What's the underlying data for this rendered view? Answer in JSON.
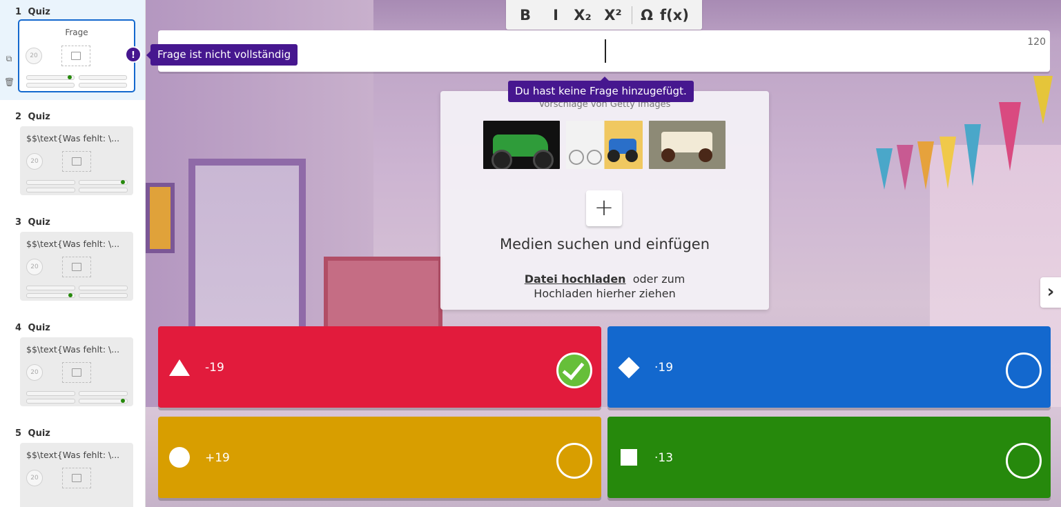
{
  "sidebar": {
    "slides": [
      {
        "number": "1",
        "type": "Quiz",
        "title": "Frage",
        "timer": "20"
      },
      {
        "number": "2",
        "type": "Quiz",
        "title": "$$\\text{Was fehlt: \\...",
        "timer": "20"
      },
      {
        "number": "3",
        "type": "Quiz",
        "title": "$$\\text{Was fehlt: \\...",
        "timer": "20"
      },
      {
        "number": "4",
        "type": "Quiz",
        "title": "$$\\text{Was fehlt: \\...",
        "timer": "20"
      },
      {
        "number": "5",
        "type": "Quiz",
        "title": "$$\\text{Was fehlt: \\...",
        "timer": "20"
      }
    ],
    "duplicate_icon": "duplicate-icon",
    "delete_icon": "trash-icon"
  },
  "toolbar": {
    "bold": "B",
    "italic": "I",
    "subscript": "X₂",
    "superscript": "X²",
    "special_chars": "Ω",
    "formula": "f(x)"
  },
  "question": {
    "value": "",
    "char_limit": "120"
  },
  "tooltips": {
    "incomplete": "Frage ist nicht vollständig",
    "incomplete_badge": "!",
    "no_question": "Du hast keine Frage hinzugefügt."
  },
  "media": {
    "suggestions_label": "Vorschläge von Getty Images",
    "add_symbol": "+",
    "heading": "Medien suchen und einfügen",
    "upload_link": "Datei hochladen",
    "upload_rest_1": "oder zum",
    "upload_rest_2": "Hochladen hierher ziehen"
  },
  "answers": [
    {
      "text": "-19",
      "shape": "triangle",
      "color": "#e21b3c",
      "correct": true
    },
    {
      "text": "·19",
      "shape": "diamond",
      "color": "#1368ce",
      "correct": false
    },
    {
      "text": "+19",
      "shape": "circle",
      "color": "#d89e00",
      "correct": false
    },
    {
      "text": "·13",
      "shape": "square",
      "color": "#26890c",
      "correct": false
    }
  ],
  "nav": {
    "next_symbol": "›"
  },
  "colors": {
    "accent": "#46178f",
    "active_border": "#1368ce"
  }
}
